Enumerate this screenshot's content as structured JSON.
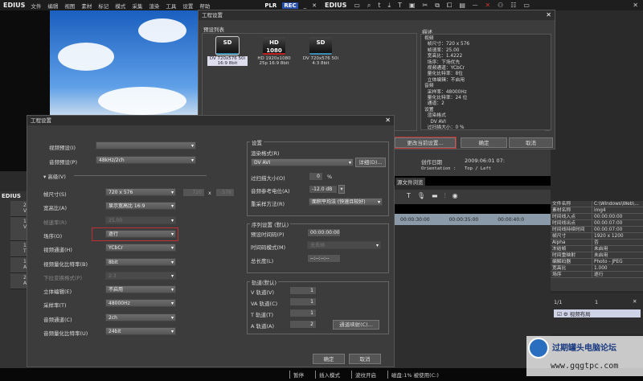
{
  "app": {
    "name": "EDIUS",
    "menu": [
      "文件",
      "编辑",
      "视图",
      "素材",
      "标记",
      "模式",
      "采集",
      "渲染",
      "工具",
      "设置",
      "帮助"
    ],
    "plr": "PLR",
    "rec": "REC"
  },
  "toolbar2": {
    "name": "EDIUS",
    "icons": [
      "folder-icon",
      "search-icon",
      "up-icon",
      "import-icon",
      "title-icon",
      "monitor-icon",
      "cut-icon",
      "copy-icon",
      "paste-icon",
      "color-bar-icon",
      "mute-icon",
      "delete-icon",
      "properties-icon",
      "view-icon",
      "grid-icon"
    ]
  },
  "back_dialog": {
    "title": "工程设置",
    "preset_list_label": "预设列表",
    "presets": [
      {
        "badge": "SD",
        "line1": "DV 720x576 50i",
        "line2": "16:9 8bit",
        "selected": true
      },
      {
        "badge": "HD 1080",
        "line1": "HD 1920x1080",
        "line2": "25p 16:9 8bit"
      },
      {
        "badge": "SD",
        "line1": "DV 720x576 50i",
        "line2": "4:3 8bit"
      }
    ],
    "desc_label": "描述",
    "description": [
      "视频",
      "  帧尺寸：720 x 576",
      "  帧速率：25.00",
      "  宽高比：1.4222",
      "  场序：下场优先",
      "  视频通道：YCbCr",
      "  量化比特率：8位",
      "  立体编辑：不启用",
      "音频",
      "  采样率：48000Hz",
      "  量化比特率：24 位",
      "  通道：2",
      "设置",
      "  渲染格式",
      "    DV AVI",
      "  过扫描大小：0 %"
    ],
    "change_btn": "更改当前设置...",
    "ok": "确定",
    "cancel": "取消"
  },
  "front_dialog": {
    "title": "工程设置",
    "left": {
      "video_preset": "视频预设(I)",
      "video_preset_val": "",
      "audio_preset": "音频预设(P)",
      "audio_preset_val": "48kHz/2ch",
      "advanced": "高级(V)",
      "rows": [
        {
          "label": "帧尺寸(S)",
          "value": "720 x 576"
        },
        {
          "label": "宽高比(A)",
          "value": "显示宽高比 16:9"
        },
        {
          "label": "帧速率(R)",
          "value": "25.00",
          "disabled": true
        },
        {
          "label": "场序(O)",
          "value": "逐行"
        },
        {
          "label": "视频通道(H)",
          "value": "YCbCr"
        },
        {
          "label": "视频量化比特率(B)",
          "value": "8bit"
        },
        {
          "label": "下拉变换格式(P)",
          "value": "2:3",
          "disabled": true
        },
        {
          "label": "立体编辑(E)",
          "value": "不启用"
        },
        {
          "label": "采样率(T)",
          "value": "48000Hz"
        },
        {
          "label": "音频通道(C)",
          "value": "2ch"
        },
        {
          "label": "音频量化比特率(U)",
          "value": "24bit"
        }
      ],
      "frame_w": "720",
      "frame_x": "x",
      "frame_h": "576"
    },
    "settings": {
      "title": "设置",
      "render_format": "渲染格式(R)",
      "render_format_val": "DV AVI",
      "detail_btn": "详细(D)...",
      "overscan": "过扫描大小(O)",
      "overscan_val": "0",
      "overscan_unit": "%",
      "audio_ref": "音频参考电位(A)",
      "audio_ref_val": "-12.0 dB",
      "resample": "重采样方法(R)",
      "resample_val": "面积平均法 (快速且较好)"
    },
    "sequence": {
      "title": "序列设置 (默认)",
      "preset_tc": "预设时间码(P)",
      "preset_tc_val": "00:00:00:00",
      "tc_mode": "时间码模式(M)",
      "tc_mode_val": "无丢帧",
      "total_len": "总长度(L)",
      "total_len_val": "--:--:--:--"
    },
    "tracks": {
      "title": "轨道(默认)",
      "items": [
        {
          "label": "V 轨道(V)",
          "value": "1"
        },
        {
          "label": "VA 轨道(C)",
          "value": "1"
        },
        {
          "label": "T 轨道(T)",
          "value": "1"
        },
        {
          "label": "A 轨道(A)",
          "value": "2"
        }
      ],
      "map_btn": "通道映射(C)..."
    },
    "ok": "确定",
    "cancel": "取消"
  },
  "clip_info": {
    "created_label": "创作日期",
    "created_val": "2009:06:01 07:",
    "orientation_label": "Orientation :",
    "orientation_val": "Top / Left",
    "browser_tab": "源文件浏览"
  },
  "timeline": {
    "ticks": [
      "00:00:30:00",
      "00:00:35:00",
      "00:00:40:0"
    ],
    "tracks": [
      "2 V",
      "1 VA",
      "1 T",
      "1 A",
      "2 A"
    ]
  },
  "properties": [
    [
      "文件名称",
      "C:\\Windows\\Web\\..."
    ],
    [
      "素材名称",
      "img4"
    ],
    [
      "时间线入点",
      "00:00:00:00"
    ],
    [
      "时间线出点",
      "00:00:07:00"
    ],
    [
      "时间线持续时间",
      "00:00:07:00"
    ],
    [
      "帧尺寸",
      "1920 x 1200"
    ],
    [
      "Alpha",
      "否"
    ],
    [
      "冻结帧",
      "未启用"
    ],
    [
      "时间重映射",
      "未启用"
    ],
    [
      "编解码器",
      "Photo - JPEG"
    ],
    [
      "宽高比",
      "1.000"
    ],
    [
      "场序",
      "逐行"
    ]
  ],
  "layer": {
    "page": "1/1",
    "count": "1",
    "item": "视频布局"
  },
  "status": [
    "暂停",
    "插入模式",
    "波纹开启",
    "磁盘:1% 被使用(C:)"
  ],
  "watermark": {
    "name": "过期罐头电脑论坛",
    "url": "www.gqgtpc.com"
  },
  "colors": {
    "highlight_box": "#c03030",
    "rec": "#2850b0"
  }
}
